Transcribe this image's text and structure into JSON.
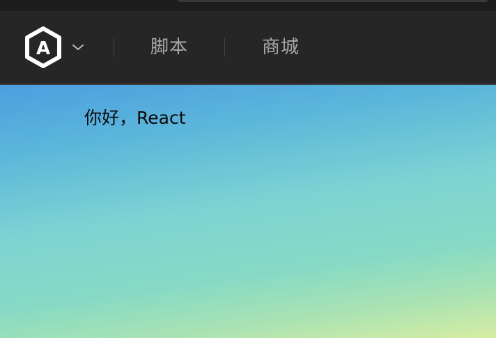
{
  "navbar": {
    "logo_icon": "angular-logo-icon",
    "logo_letter": "A",
    "dropdown_icon": "chevron-down-icon",
    "links": [
      {
        "label": "脚本"
      },
      {
        "label": "商城"
      }
    ]
  },
  "main": {
    "greeting": "你好，React"
  },
  "colors": {
    "navbar_bg": "#262626",
    "nav_link": "#a8a8a8",
    "gradient_top": "#4c9fe0",
    "gradient_mid": "#7dd3d2",
    "gradient_bottom": "#d6eda3"
  }
}
